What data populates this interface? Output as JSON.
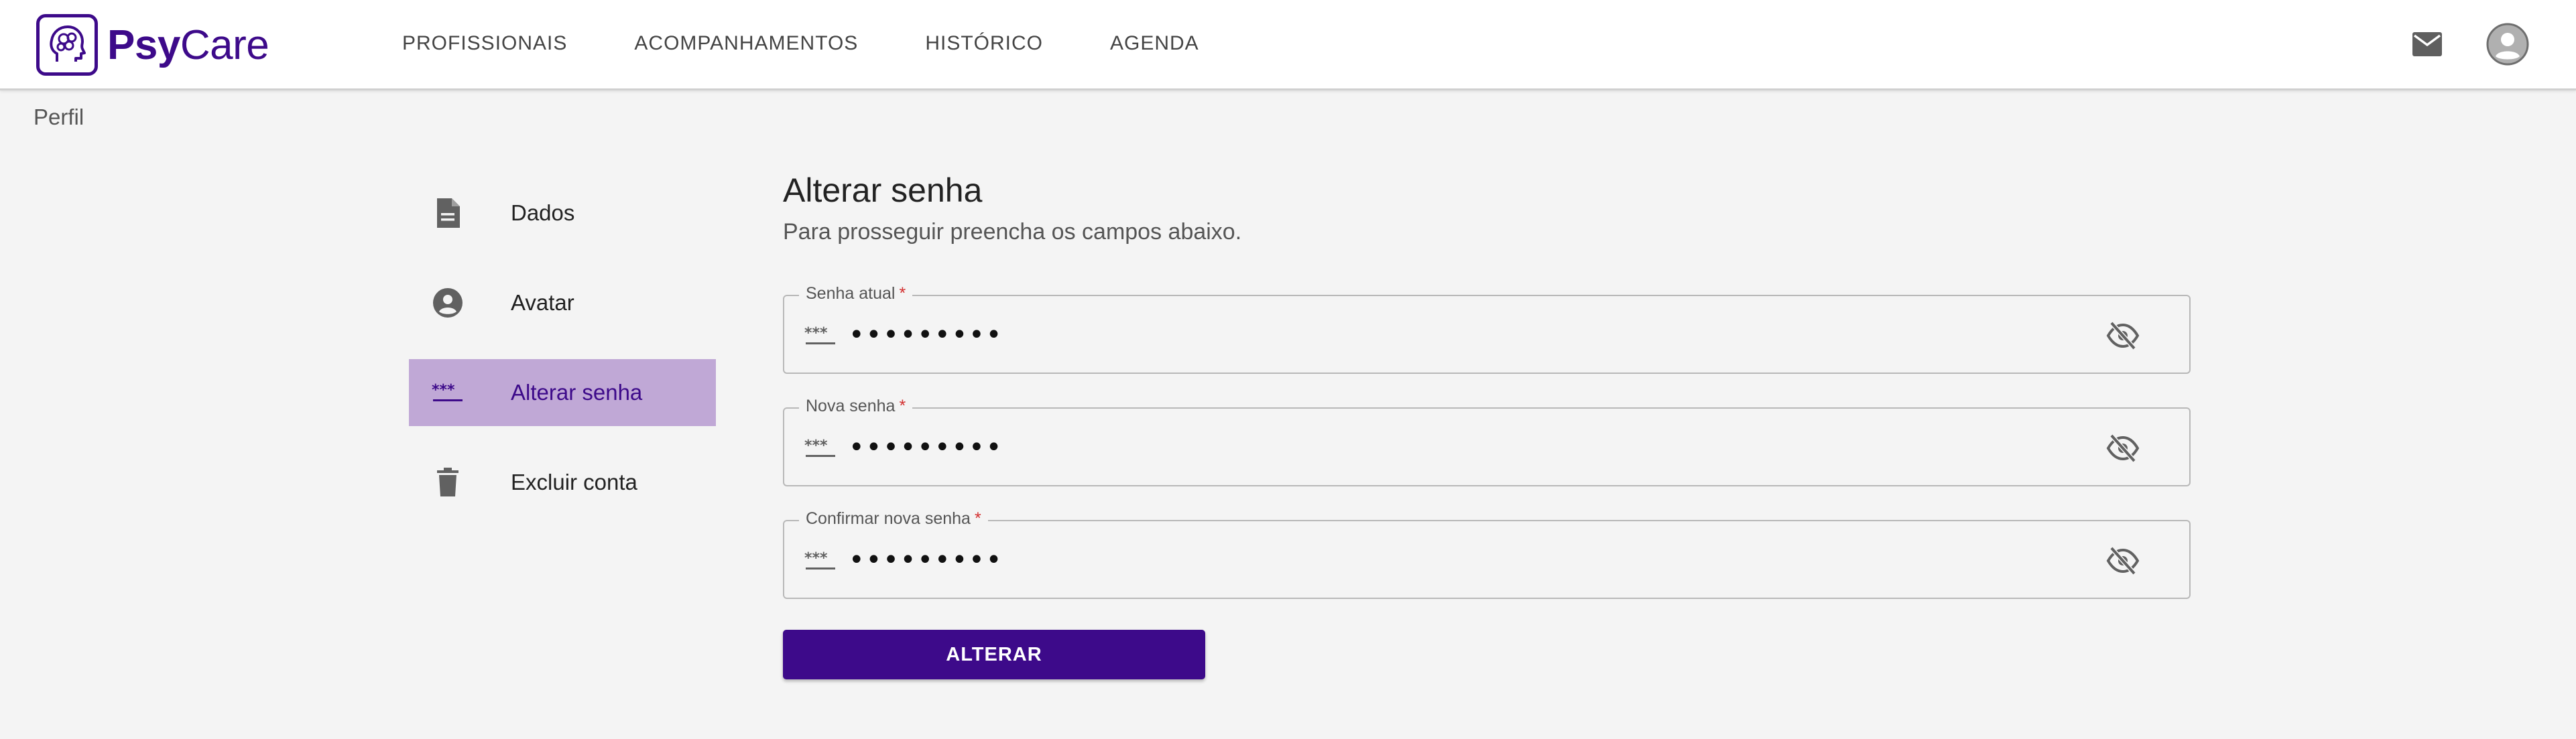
{
  "app": {
    "brand_bold": "Psy",
    "brand_light": "Care",
    "brand_color": "#3d0a8a"
  },
  "nav": {
    "items": [
      {
        "label": "PROFISSIONAIS"
      },
      {
        "label": "ACOMPANHAMENTOS"
      },
      {
        "label": "HISTÓRICO"
      },
      {
        "label": "AGENDA"
      }
    ]
  },
  "header_icons": {
    "mail": "mail-icon",
    "avatar": "account-circle-icon"
  },
  "breadcrumb": "Perfil",
  "sidebar": {
    "items": [
      {
        "label": "Dados",
        "icon": "document-icon"
      },
      {
        "label": "Avatar",
        "icon": "account-circle-icon"
      },
      {
        "label": "Alterar senha",
        "icon": "password-icon",
        "active": true
      },
      {
        "label": "Excluir conta",
        "icon": "trash-icon"
      }
    ],
    "active_bg": "#c0a8d6"
  },
  "form": {
    "title": "Alterar senha",
    "subtitle": "Para prosseguir preencha os campos abaixo.",
    "fields": [
      {
        "label": "Senha atual",
        "required_mark": "*",
        "value": "•••••••••"
      },
      {
        "label": "Nova senha",
        "required_mark": "*",
        "value": "•••••••••"
      },
      {
        "label": "Confirmar nova senha",
        "required_mark": "*",
        "value": "•••••••••"
      }
    ],
    "submit_label": "ALTERAR"
  }
}
